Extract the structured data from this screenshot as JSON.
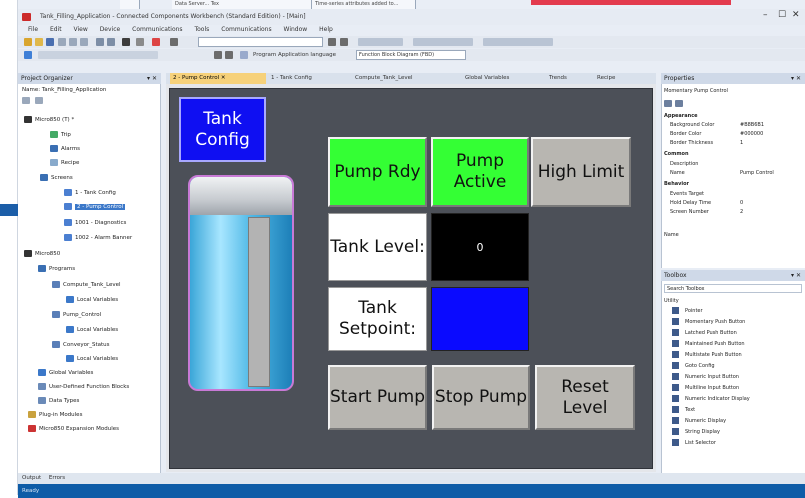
{
  "window": {
    "title": "Tank_Filling_Application - Connected Components Workbench (Standard Edition) - [Main]",
    "minimize": "–",
    "maximize": "☐",
    "close": "✕"
  },
  "desktop": {
    "tab1": "Data Server... Tex",
    "tab2": "Time-series attributes added to..."
  },
  "menu": [
    "File",
    "Edit",
    "View",
    "Device",
    "Communications",
    "Tools",
    "Communications",
    "Window",
    "Help"
  ],
  "toolbar": {
    "search_placeholder": "",
    "language_label": "Program Application language",
    "language_value": "Function Block Diagram (FBD)"
  },
  "project_organizer": {
    "title": "Project Organizer",
    "project_label": "Name: Tank_Filling_Application",
    "items": [
      {
        "label": "Micro850 (T) *"
      },
      {
        "label": "Trip"
      },
      {
        "label": "Alarms"
      },
      {
        "label": "Recipe"
      },
      {
        "label": "Screens"
      },
      {
        "label": "1 - Tank Config"
      },
      {
        "label": "2 - Pump Control"
      },
      {
        "label": "1001 - Diagnostics"
      },
      {
        "label": "1002 - Alarm Banner"
      },
      {
        "label": "Micro850"
      },
      {
        "label": "Programs"
      },
      {
        "label": "Compute_Tank_Level"
      },
      {
        "label": "Local Variables"
      },
      {
        "label": "Pump_Control"
      },
      {
        "label": "Local Variables"
      },
      {
        "label": "Conveyor_Status"
      },
      {
        "label": "Local Variables"
      },
      {
        "label": "Global Variables"
      },
      {
        "label": "User-Defined Function Blocks"
      },
      {
        "label": "Data Types"
      },
      {
        "label": "Plug-in Modules"
      },
      {
        "label": "Micro850 Expansion Modules"
      }
    ]
  },
  "tabs": [
    {
      "label": "2 - Pump Control",
      "active": true
    },
    {
      "label": "1 - Tank Config"
    },
    {
      "label": "Compute_Tank_Level"
    },
    {
      "label": "Global Variables"
    },
    {
      "label": "Trends"
    },
    {
      "label": "Recipe"
    }
  ],
  "hmi": {
    "tank_config": "Tank Config",
    "pump_rdy": "Pump Rdy",
    "pump_active": "Pump Active",
    "high_limit": "High Limit",
    "tank_level_label": "Tank Level:",
    "tank_level_value": "0",
    "tank_setpoint_label": "Tank Setpoint:",
    "start_pump": "Start Pump",
    "stop_pump": "Stop Pump",
    "reset_level": "Reset Level",
    "colors": {
      "panel": "#4c5058",
      "active_green": "#34ff34",
      "nav_blue": "#0f0ff2",
      "button_gray": "#b8b6b1"
    }
  },
  "properties": {
    "title": "Properties",
    "object": "Momentary Pump Control",
    "group_appearance": "Appearance",
    "rows": [
      {
        "k": "Background Color",
        "v": "#B8B6B1"
      },
      {
        "k": "Border Color",
        "v": "#000000"
      },
      {
        "k": "Border Thickness",
        "v": "1"
      },
      {
        "k": "Common",
        "v": ""
      },
      {
        "k": "Description",
        "v": ""
      },
      {
        "k": "Name",
        "v": "Pump Control"
      },
      {
        "k": "Behavior",
        "v": ""
      },
      {
        "k": "Events Target",
        "v": ""
      },
      {
        "k": "Hold Delay Time",
        "v": "0"
      },
      {
        "k": "Screen Number",
        "v": "2"
      }
    ],
    "name_section": "Name"
  },
  "toolbox": {
    "title": "Toolbox",
    "search_placeholder": "Search Toolbox",
    "category": "Utility",
    "items": [
      "Pointer",
      "Momentary Push Button",
      "Latched Push Button",
      "Maintained Push Button",
      "Multistate Push Button",
      "Goto Config",
      "Numeric Input Button",
      "Multiline Input Button",
      "Numeric Indicator Display",
      "Text",
      "Numeric Display",
      "String Display",
      "List Selector"
    ]
  },
  "bottom": {
    "output": "Output",
    "errors": "Errors",
    "status": "Ready"
  }
}
